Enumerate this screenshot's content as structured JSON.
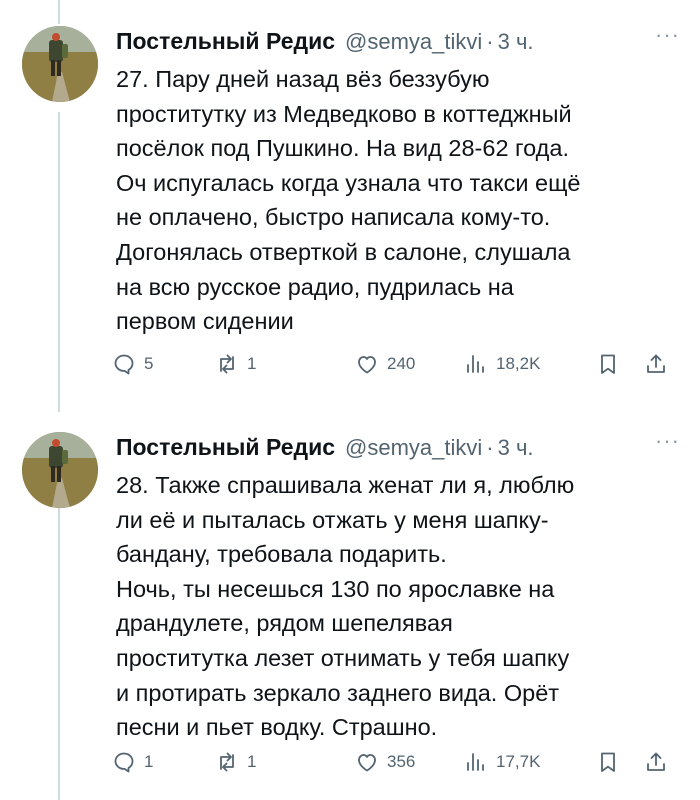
{
  "tweets": [
    {
      "author": "Постельный Редис",
      "handle": "@semya_tikvi",
      "separator": "·",
      "time": "3 ч.",
      "more": "···",
      "text_lines": [
        "27. Пару дней назад вёз беззубую",
        "проститутку из Медведково в коттеджный",
        "посёлок под Пушкино. На вид 28-62 года.",
        "Оч испугалась когда узнала что такси ещё",
        "не оплачено, быстро написала кому-то.",
        "Догонялась отверткой в салоне, слушала",
        "на всю русское радио, пудрилась на",
        "первом сидении"
      ],
      "replies": "5",
      "retweets": "1",
      "likes": "240",
      "views": "18,2K"
    },
    {
      "author": "Постельный Редис",
      "handle": "@semya_tikvi",
      "separator": "·",
      "time": "3 ч.",
      "more": "···",
      "text_lines": [
        "28. Также спрашивала женат ли я, люблю",
        "ли её и пыталась отжать у меня шапку-",
        "бандану, требовала подарить.",
        "Ночь, ты несешься 130 по ярославке на",
        "драндулете, рядом шепелявая",
        "проститутка лезет отнимать у тебя шапку",
        "и протирать зеркало заднего вида. Орёт",
        "песни и пьет водку. Страшно."
      ],
      "replies": "1",
      "retweets": "1",
      "likes": "356",
      "views": "17,7K"
    }
  ],
  "icons": {
    "reply": "reply-icon",
    "retweet": "retweet-icon",
    "like": "heart-icon",
    "views": "views-icon",
    "bookmark": "bookmark-icon",
    "share": "share-icon"
  },
  "colors": {
    "text": "#0f1419",
    "secondary": "#536471",
    "thread_line": "#cfd9de"
  }
}
